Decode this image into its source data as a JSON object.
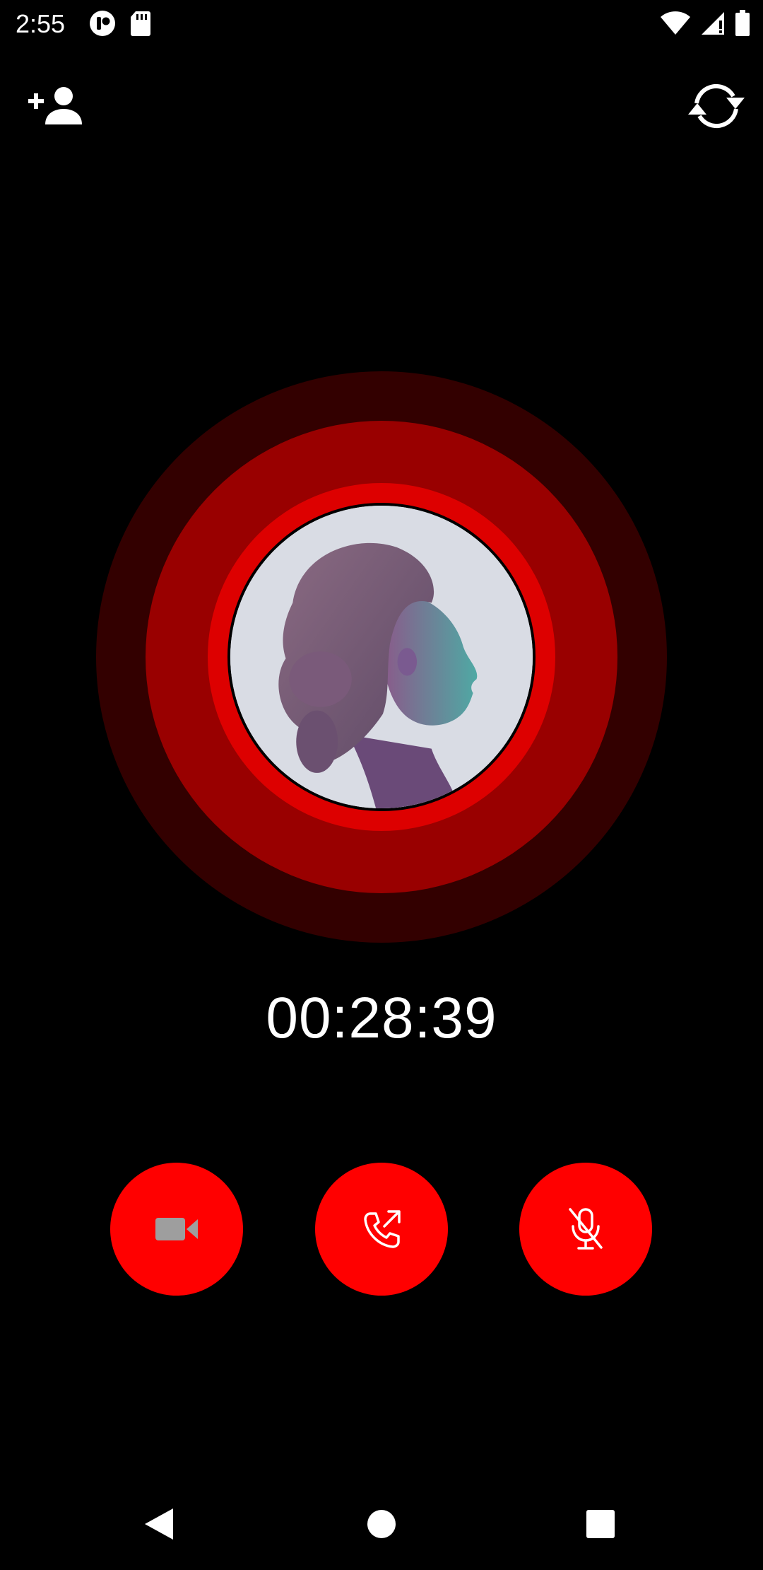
{
  "status_bar": {
    "time": "2:55",
    "left_icons": [
      "app-notification-icon",
      "sd-card-icon"
    ],
    "right_icons": [
      "wifi-icon",
      "cellular-signal-icon",
      "battery-icon"
    ]
  },
  "top_actions": {
    "add_person_icon": "add-person-icon",
    "switch_camera_icon": "switch-camera-icon"
  },
  "call": {
    "timer": "00:28:39"
  },
  "controls": [
    {
      "name": "video",
      "icon": "video-camera-icon",
      "enabled": false
    },
    {
      "name": "transfer-call",
      "icon": "phone-outgoing-icon"
    },
    {
      "name": "mute",
      "icon": "microphone-off-icon"
    }
  ],
  "colors": {
    "background": "#000000",
    "button_red": "#ff0000",
    "ring_outer": "#330000",
    "ring_mid": "#990000",
    "ring_inner": "#dd0000",
    "disabled_icon": "#9e9e9e"
  },
  "nav_bar": {
    "icons": [
      "back-icon",
      "home-icon",
      "recents-icon"
    ]
  }
}
